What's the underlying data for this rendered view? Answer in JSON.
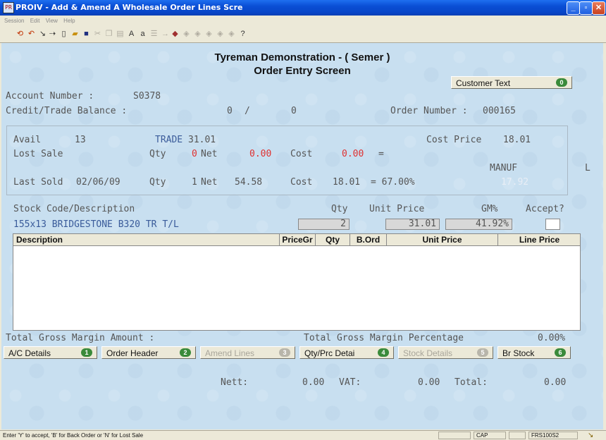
{
  "window": {
    "title": "PROIV - Add & Amend A Wholesale Order Lines Scre",
    "app_icon_label": "PR"
  },
  "menu": [
    "Session",
    "Edit",
    "View",
    "Help"
  ],
  "header": {
    "line1": "Tyreman Demonstration - ( Semer )",
    "line2": "Order Entry Screen"
  },
  "customer_text_button": {
    "label": "Customer Text",
    "key": "0"
  },
  "account": {
    "label": "Account Number :",
    "value": "S0378",
    "balance_label": "Credit/Trade Balance :",
    "balance_a": "0",
    "balance_sep": "/",
    "balance_b": "0",
    "order_label": "Order Number :",
    "order_value": "000165"
  },
  "stock_panel": {
    "avail_label": "Avail",
    "avail_value": "13",
    "trade_label": "TRADE",
    "trade_value": "31.01",
    "cost_price_label": "Cost Price",
    "cost_price_value": "18.01",
    "lost_sale_label": "Lost Sale",
    "lost_qty_label": "Qty",
    "lost_qty_value": "0",
    "lost_net_label": "Net",
    "lost_net_value": "0.00",
    "lost_cost_label": "Cost",
    "lost_cost_value": "0.00",
    "lost_eq": "=",
    "manuf_label": "MANUF",
    "manuf_value": "17.92",
    "l_label": "L",
    "last_sold_label": "Last Sold",
    "last_sold_date": "02/06/09",
    "last_qty_label": "Qty",
    "last_qty_value": "1",
    "last_net_label": "Net",
    "last_net_value": "54.58",
    "last_cost_label": "Cost",
    "last_cost_value": "18.01",
    "last_margin": "= 67.00%"
  },
  "line_entry": {
    "stock_label": "Stock Code/Description",
    "qty_label": "Qty",
    "unit_price_label": "Unit Price",
    "gm_label": "GM%",
    "accept_label": "Accept?",
    "stock_value": "155x13 BRIDGESTONE B320 TR T/L",
    "qty_value": "2",
    "unit_price_value": "31.01",
    "gm_value": "41.92%",
    "accept_value": ""
  },
  "grid": {
    "columns": [
      "Description",
      "PriceGr",
      "Qty",
      "B.Ord",
      "Unit Price",
      "Line Price"
    ],
    "rows": []
  },
  "totals": {
    "gross_amount_label": "Total Gross Margin Amount :",
    "gross_amount_value": "",
    "gross_pct_label": "Total Gross Margin Percentage",
    "gross_pct_value": "0.00%",
    "nett_label": "Nett:",
    "nett_value": "0.00",
    "vat_label": "VAT:",
    "vat_value": "0.00",
    "total_label": "Total:",
    "total_value": "0.00"
  },
  "function_buttons": [
    {
      "label": "A/C Details",
      "key": "1",
      "enabled": true
    },
    {
      "label": "Order Header",
      "key": "2",
      "enabled": true
    },
    {
      "label": "Amend Lines",
      "key": "3",
      "enabled": false
    },
    {
      "label": "Qty/Prc Detai",
      "key": "4",
      "enabled": true
    },
    {
      "label": "Stock Details",
      "key": "5",
      "enabled": false
    },
    {
      "label": "Br Stock",
      "key": "6",
      "enabled": true
    }
  ],
  "status": {
    "message": "Enter 'Y' to accept, 'B' for Back Order or 'N' for Lost Sale",
    "caps": "CAP",
    "screen_id": "FRS100S2"
  },
  "colors": {
    "background": "#c8dff0",
    "label_text": "#555555",
    "value_blue": "#3a5b9a",
    "value_red": "#e03030",
    "fkey_green": "#3a8a3a"
  }
}
